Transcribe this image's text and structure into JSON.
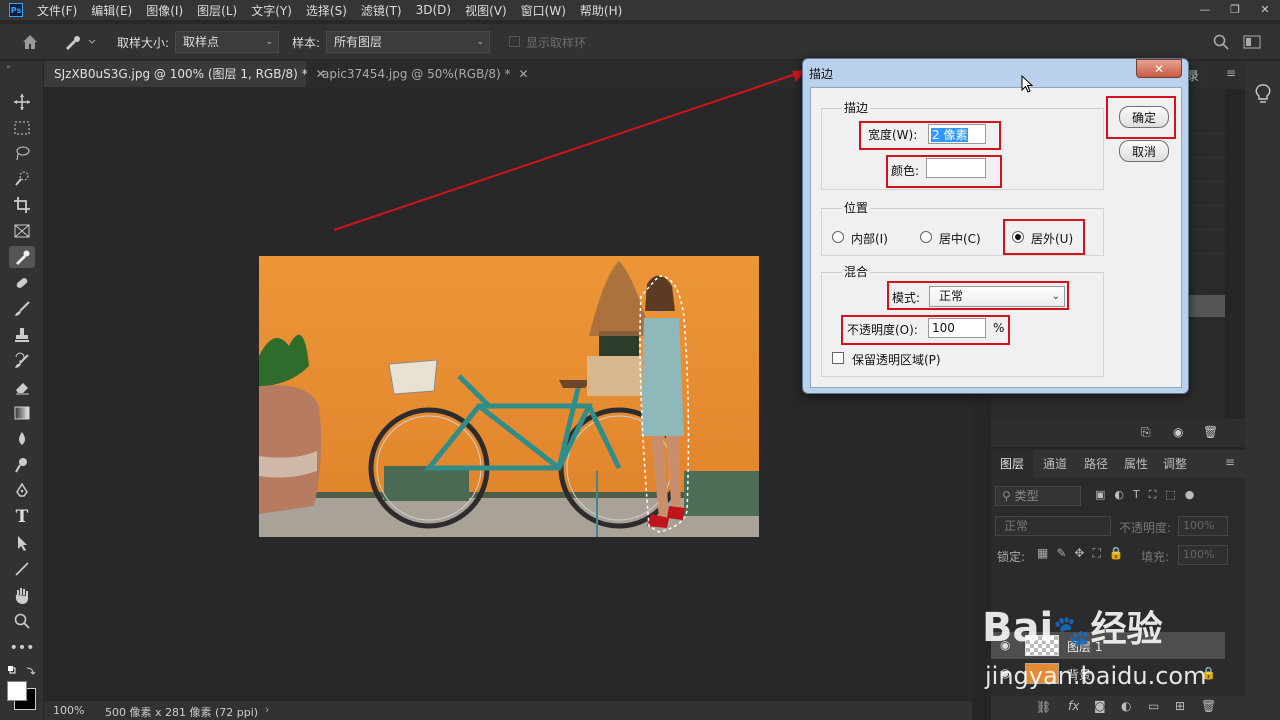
{
  "menubar": {
    "logo": "Ps",
    "items": [
      "文件(F)",
      "编辑(E)",
      "图像(I)",
      "图层(L)",
      "文字(Y)",
      "选择(S)",
      "滤镜(T)",
      "3D(D)",
      "视图(V)",
      "窗口(W)",
      "帮助(H)"
    ]
  },
  "options": {
    "sample_size_label": "取样大小:",
    "sample_size_value": "取样点",
    "sample_label": "样本:",
    "sample_value": "所有图层",
    "show_ring_label": "显示取样环"
  },
  "tabs": [
    {
      "label": "SJzXB0uS3G.jpg @ 100% (图层 1, RGB/8) *"
    },
    {
      "label": "apic37454.jpg @ 50%(RGB/8) *"
    }
  ],
  "status": {
    "zoom": "100%",
    "doc_size": "500 像素 x 281 像素 (72 ppi)"
  },
  "dialog": {
    "title": "描边",
    "stroke_group": "描边",
    "width_label": "宽度(W):",
    "width_value": "2 像素",
    "color_label": "颜色:",
    "color_value": "#ffffff",
    "position_group": "位置",
    "position_options": [
      "内部(I)",
      "居中(C)",
      "居外(U)"
    ],
    "position_selected": "居外(U)",
    "blend_group": "混合",
    "mode_label": "模式:",
    "mode_value": "正常",
    "opacity_label": "不透明度(O):",
    "opacity_value": "100",
    "opacity_unit": "%",
    "preserve_label": "保留透明区域(P)",
    "ok_label": "确定",
    "cancel_label": "取消"
  },
  "layers_panel": {
    "tabs": [
      "图层",
      "通道",
      "路径",
      "属性",
      "调整"
    ],
    "filter_placeholder": "类型",
    "blend_mode": "正常",
    "opacity_label": "不透明度:",
    "opacity_value": "100%",
    "lock_label": "锁定:",
    "fill_label": "填充:",
    "fill_value": "100%",
    "layers": [
      "图层 1",
      "背景"
    ],
    "top_tab_fragment": "录"
  },
  "watermark": {
    "brand": "Bai",
    "brand_suffix": "经验",
    "url": "jingyan.baidu.com"
  },
  "colors": {
    "annotation_red": "#d0131c",
    "dialog_frame": "#b9d1ea",
    "selection_blue": "#3399ff"
  }
}
